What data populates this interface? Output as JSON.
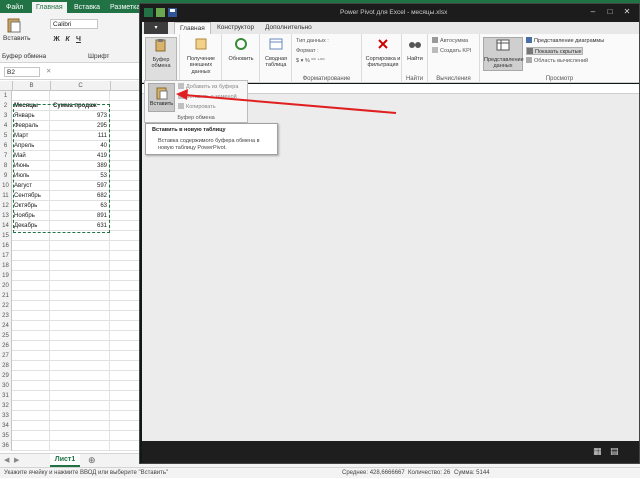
{
  "excel": {
    "tabs": [
      "Файл",
      "Главная",
      "Вставка",
      "Разметка стр"
    ],
    "active_tab_index": 1,
    "clipboard_paste_label": "Вставить",
    "clipboard_group_label": "Буфер обмена",
    "font_name": "Calibri",
    "font_group_label": "Шрифт",
    "name_box": "B2",
    "columns": [
      "B",
      "C"
    ],
    "headers": {
      "a": "Месяцы",
      "b": "Сумма продаж"
    },
    "rows": [
      {
        "month": "Январь",
        "value": "973"
      },
      {
        "month": "Февраль",
        "value": "295"
      },
      {
        "month": "Март",
        "value": "111"
      },
      {
        "month": "Апрель",
        "value": "40"
      },
      {
        "month": "Май",
        "value": "419"
      },
      {
        "month": "Июнь",
        "value": "389"
      },
      {
        "month": "Июль",
        "value": "53"
      },
      {
        "month": "Август",
        "value": "597"
      },
      {
        "month": "Сентябрь",
        "value": "682"
      },
      {
        "month": "Октябрь",
        "value": "63"
      },
      {
        "month": "Ноябрь",
        "value": "891"
      },
      {
        "month": "Декабрь",
        "value": "631"
      }
    ],
    "sheet_tab": "Лист1",
    "add_sheet": "⊕",
    "status_left": "Укажите ячейку и нажмите ВВОД или выберите \"Вставить\"",
    "status_avg": "Среднее: 428,6666667",
    "status_count": "Количество: 26",
    "status_sum": "Сумма: 5144"
  },
  "pp": {
    "title": "Power Pivot для Excel - месяцы.xlsx",
    "file_label": "▾",
    "tabs": [
      "Главная",
      "Конструктор",
      "Дополнительно"
    ],
    "buttons": {
      "clipboard": "Буфер обмена",
      "get_data": "Получение внешних данных",
      "refresh": "Обновить",
      "pivot": "Сводная таблица",
      "data_type": "Тип данных :",
      "format": "Формат :",
      "sort": "Сортировка и фильтрация",
      "find": "Найти",
      "autosum": "Автосумма",
      "create_kpi": "Создать KPI",
      "data_view": "Представление данных",
      "diagram_view": "Представление диаграммы",
      "show_hidden": "Показать скрытые",
      "calc_area": "Область вычислений"
    },
    "groups": {
      "format_label": "Форматирование",
      "find_label": "Найти",
      "calc_label": "Вычисления",
      "view_label": "Просмотр"
    },
    "dropdown": {
      "paste": "Вставить",
      "add_from_clipboard": "Добавить из буфера",
      "paste_replace": "Вставить с заменой",
      "copy": "Копировать",
      "group_label": "Буфер обмена"
    },
    "tooltip": {
      "title": "Вставить в новую таблицу",
      "body": "Вставка содержимого буфера обмена в новую таблицу PowerPivot."
    }
  },
  "colors": {
    "excel_green": "#217346",
    "arrow_red": "#e02020"
  }
}
